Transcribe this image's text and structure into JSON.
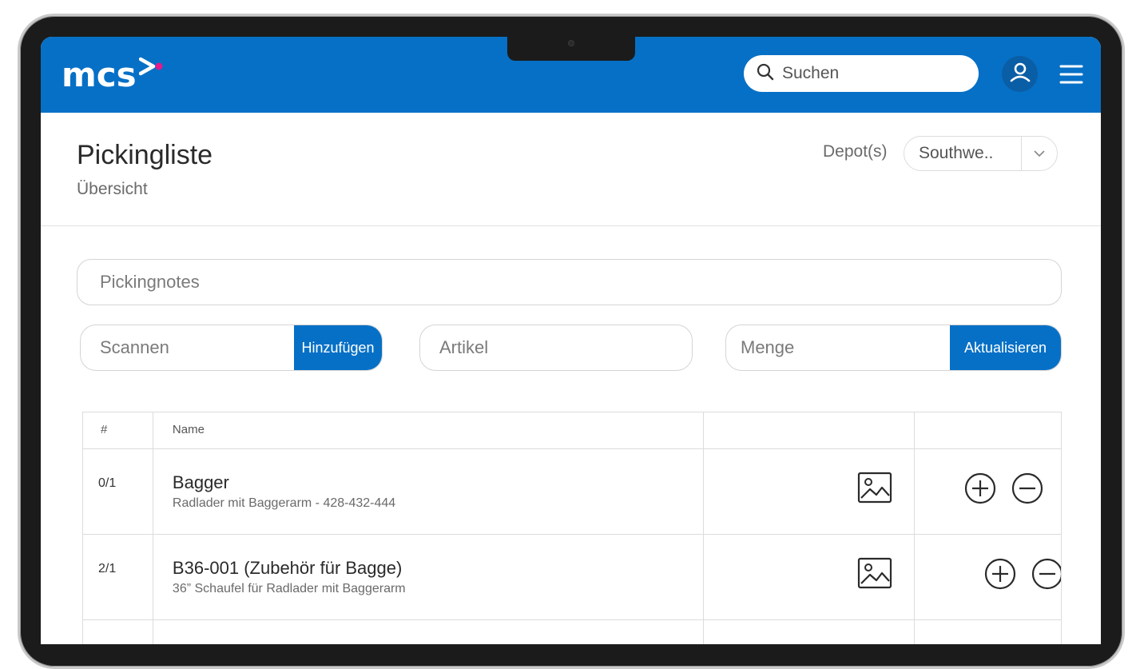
{
  "header": {
    "logo_text": "mcs",
    "search_placeholder": "Suchen",
    "brand_color": "#0670c6",
    "accent_color": "#e21b8c"
  },
  "page": {
    "title": "Pickingliste",
    "subtitle": "Übersicht",
    "depot_label": "Depot(s)",
    "depot_value": "Southwe.."
  },
  "form": {
    "pickingnotes_placeholder": "Pickingnotes",
    "scan_placeholder": "Scannen",
    "add_label": "Hinzufügen",
    "article_placeholder": "Artikel",
    "quantity_placeholder": "Menge",
    "update_label": "Aktualisieren"
  },
  "table": {
    "headers": {
      "num": "#",
      "name": "Name"
    },
    "rows": [
      {
        "count": "0/1",
        "name": "Bagger",
        "description": "Radlader mit Baggerarm - 428-432-444"
      },
      {
        "count": "2/1",
        "name": "B36-001 (Zubehör für Bagge)",
        "description": "36” Schaufel für Radlader mit Baggerarm"
      }
    ]
  }
}
